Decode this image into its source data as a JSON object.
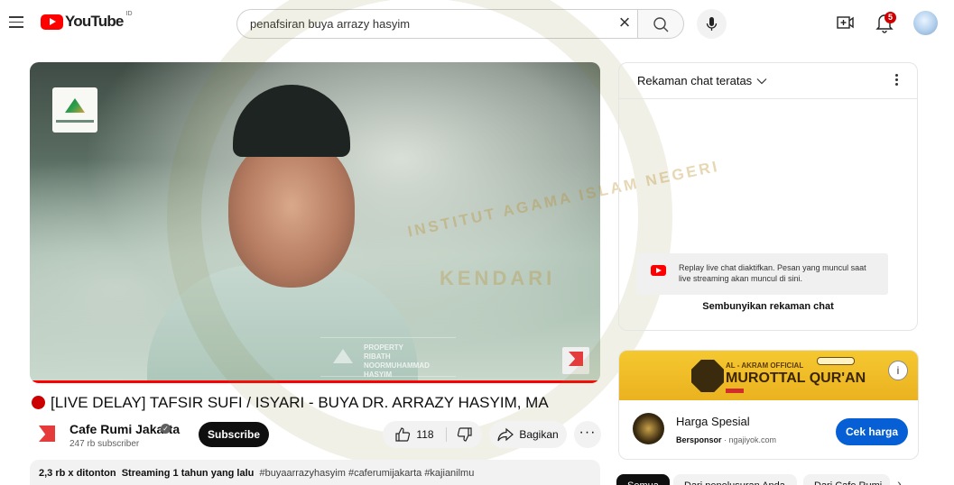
{
  "header": {
    "logo_text": "YouTube",
    "logo_country": "ID",
    "search_value": "penafsiran buya arrazy hasyim",
    "notification_count": "5"
  },
  "video": {
    "watermark_lines": [
      "PROPERTY",
      "RIBATH NOORMUHAMMAD",
      "HASYIM"
    ],
    "page_watermark_line1": "INSTITUT AGAMA ISLAM NEGERI",
    "page_watermark_line2": "KENDARI"
  },
  "meta": {
    "title": "[LIVE DELAY] TAFSIR SUFI / ISYARI - BUYA DR. ARRAZY HASYIM, MA",
    "channel_name": "Cafe Rumi Jakarta",
    "subscribers": "247 rb subscriber",
    "subscribe_label": "Subscribe",
    "like_count": "118",
    "share_label": "Bagikan",
    "views": "2,3 rb x ditonton",
    "streamed": "Streaming 1 tahun yang lalu",
    "hashtags": "#buyaarrazyhasyim #caferumijakarta #kajianilmu"
  },
  "chat": {
    "title": "Rekaman chat teratas",
    "replay_notice": "Replay live chat diaktifkan. Pesan yang muncul saat live streaming akan muncul di sini.",
    "hide_label": "Sembunyikan rekaman chat"
  },
  "ad": {
    "banner_line1": "AL - AKRAM OFFICIAL",
    "banner_line2": "MUROTTAL QUR'AN",
    "title": "Harga Spesial",
    "sponsor_label": "Bersponsor",
    "sponsor_domain": "ngajiyok.com",
    "cta": "Cek harga"
  },
  "chips": [
    "Semua",
    "Dari penelusuran Anda",
    "Dari Cafe Rumi"
  ],
  "colors": {
    "brand_red": "#ff0000",
    "cta_blue": "#065fd4",
    "live_red": "#cc0000"
  }
}
